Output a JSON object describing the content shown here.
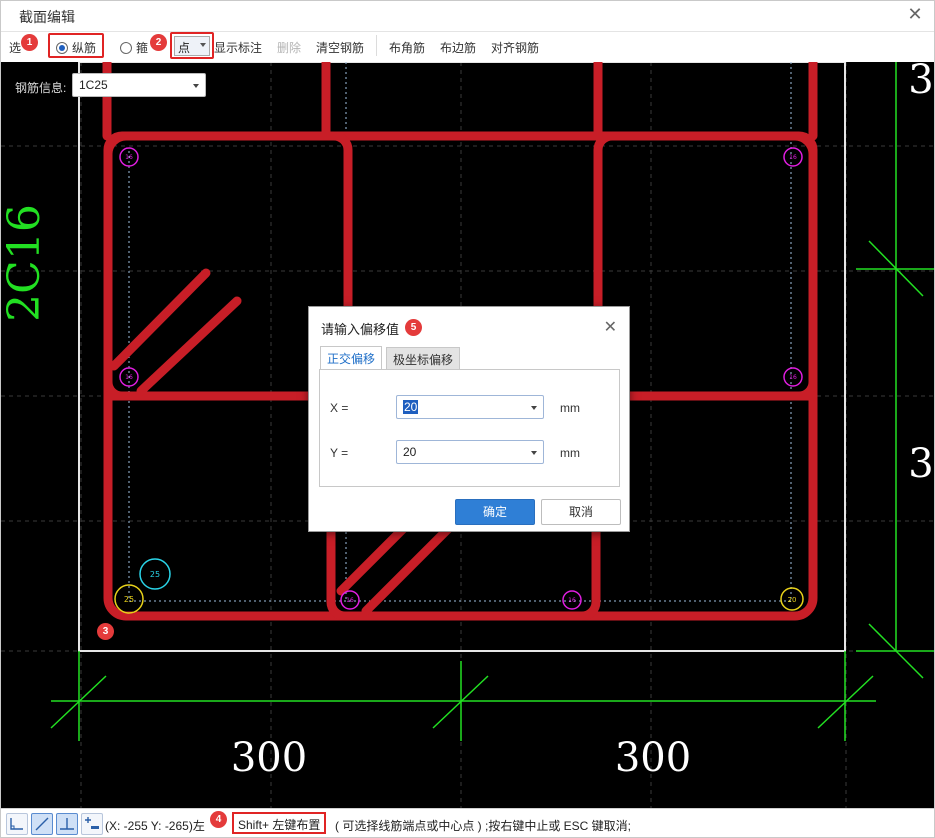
{
  "window": {
    "title": "截面编辑"
  },
  "toolbar": {
    "select_label": "选",
    "longitudinal_label": "纵筋",
    "stirrup_label": "箍",
    "point_mode_label": "点",
    "show_annotation": "显示标注",
    "delete": "删除",
    "clear_rebar": "清空钢筋",
    "corner_rebar": "布角筋",
    "edge_rebar": "布边筋",
    "align_rebar": "对齐钢筋"
  },
  "badges": {
    "b1": "1",
    "b2": "2",
    "b3": "3",
    "b4": "4",
    "b5": "5"
  },
  "rebar_info": {
    "label": "钢筋信息:",
    "value": "1C25"
  },
  "canvas": {
    "side_label": "2C16",
    "dim_left": "300",
    "dim_right": "300",
    "dim_right_top": "3",
    "dim_right_mid": "3",
    "bar_labels": {
      "corner_bottom_left": "25",
      "corner_bottom_right": "20",
      "preview": "25",
      "small": "16"
    }
  },
  "dialog": {
    "title": "请输入偏移值",
    "tab_ortho": "正交偏移",
    "tab_polar": "极坐标偏移",
    "x_label": "X =",
    "x_value": "20",
    "y_label": "Y =",
    "y_value": "20",
    "unit": "mm",
    "ok": "确定",
    "cancel": "取消"
  },
  "statusbar": {
    "coords_text": "(X: -255 Y: -265)左",
    "hint_key": "Shift+ 左键布置",
    "hint_rest": "( 可选择线筋端点或中心点 ) ;按右键中止或 ESC 键取消;"
  },
  "colors": {
    "rebar_red": "#c81e27",
    "dim_green": "#22e022",
    "magenta": "#e01ee0",
    "yellow": "#e8d21a",
    "cyan": "#2ad4e8",
    "accent_blue": "#2f7fd6"
  }
}
